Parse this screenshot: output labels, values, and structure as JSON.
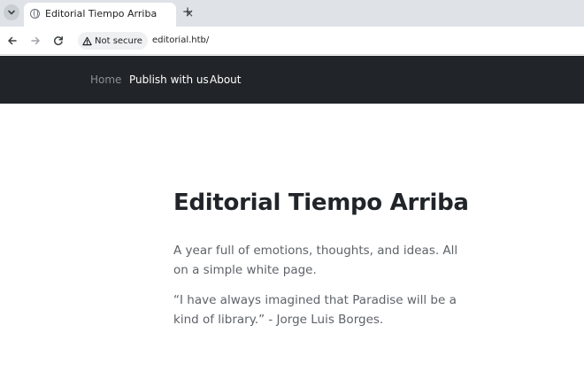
{
  "browser": {
    "tab": {
      "title": "Editorial Tiempo Arriba",
      "close_icon": "×"
    },
    "new_tab_icon": "+",
    "security_label": "Not secure",
    "url": "editorial.htb/"
  },
  "site": {
    "nav": {
      "items": [
        {
          "label": "Home",
          "active": true
        },
        {
          "label": "Publish with us"
        },
        {
          "label": "About"
        }
      ]
    },
    "title": "Editorial Tiempo Arriba",
    "lead": "A year full of emotions, thoughts, and ideas. All on a simple white page.",
    "quote": "“I have always imagined that Paradise will be a kind of library.” - Jorge Luis Borges."
  },
  "colors": {
    "navbar_bg": "#212529",
    "tab_strip_bg": "#dfe3e7",
    "text_dark": "#212529",
    "text_muted": "#5f6368"
  }
}
